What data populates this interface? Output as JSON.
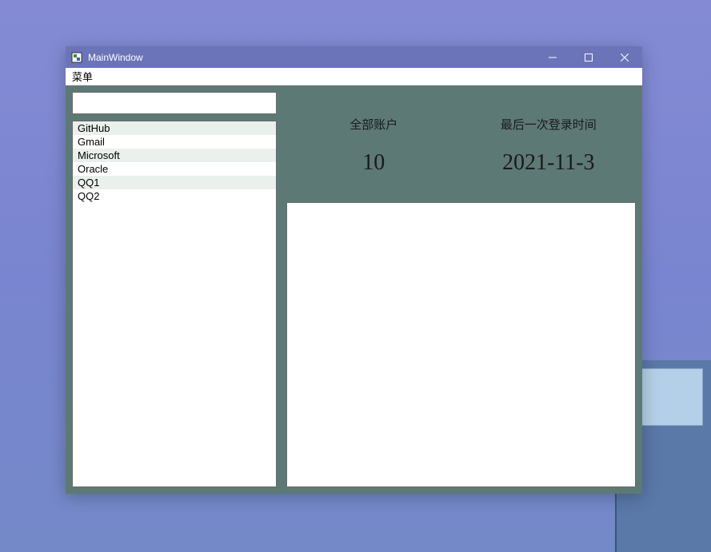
{
  "window": {
    "title": "MainWindow"
  },
  "menubar": {
    "menu_label": "菜单"
  },
  "search": {
    "value": "",
    "placeholder": ""
  },
  "accounts": [
    {
      "name": "GitHub"
    },
    {
      "name": "Gmail"
    },
    {
      "name": "Microsoft"
    },
    {
      "name": "Oracle"
    },
    {
      "name": "QQ1"
    },
    {
      "name": "QQ2"
    }
  ],
  "stats": {
    "total_label": "全部账户",
    "total_value": "10",
    "lastlogin_label": "最后一次登录时间",
    "lastlogin_value": "2021-11-3"
  }
}
